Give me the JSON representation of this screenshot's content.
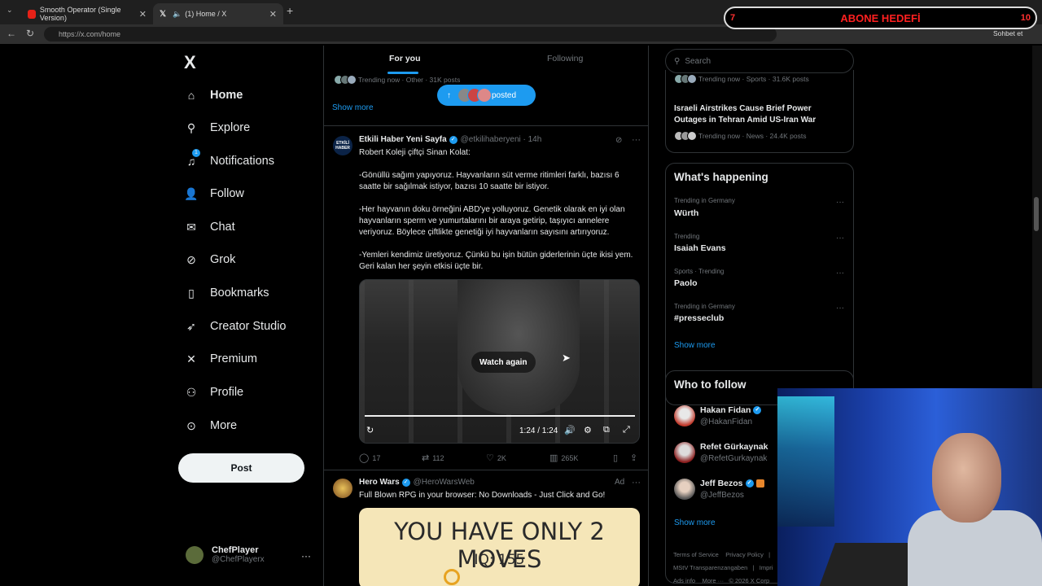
{
  "browser": {
    "tabs": [
      {
        "title": "Smooth Operator (Single Version)",
        "active": false
      },
      {
        "title": "(1) Home / X",
        "active": true
      }
    ],
    "url": "https://x.com/home",
    "chat_button": "Sohbet et"
  },
  "stream_overlay": {
    "banner": "ABONE HEDEFİ",
    "left_num": "7",
    "right_num": "10"
  },
  "sidebar": {
    "logo": "X",
    "items": [
      {
        "label": "Home",
        "icon": "home-icon"
      },
      {
        "label": "Explore",
        "icon": "search-icon"
      },
      {
        "label": "Notifications",
        "icon": "bell-icon",
        "badge": "1"
      },
      {
        "label": "Follow",
        "icon": "person-add-icon"
      },
      {
        "label": "Chat",
        "icon": "mail-icon"
      },
      {
        "label": "Grok",
        "icon": "grok-icon"
      },
      {
        "label": "Bookmarks",
        "icon": "bookmark-icon"
      },
      {
        "label": "Creator Studio",
        "icon": "rocket-icon"
      },
      {
        "label": "Premium",
        "icon": "x-icon"
      },
      {
        "label": "Profile",
        "icon": "person-icon"
      },
      {
        "label": "More",
        "icon": "more-circle-icon"
      }
    ],
    "post_button": "Post",
    "account": {
      "name": "ChefPlayer",
      "handle": "@ChefPlayerx"
    }
  },
  "feed": {
    "tabs": [
      "For you",
      "Following"
    ],
    "top_trend": "Trending now · Other · 31K posts",
    "show_more": "Show more",
    "posted_pill": "posted",
    "tweet1": {
      "name": "Etkili Haber Yeni Sayfa",
      "handle": "@etkilihaberyeni · 14h",
      "avatar_text": "ETKİLİ HABER",
      "body": "Robert Koleji çiftçi Sinan Kolat:\n\n-Gönüllü sağım yapıyoruz. Hayvanların süt verme ritimleri farklı, bazısı 6 saatte bir sağılmak istiyor, bazısı 10 saatte bir istiyor.\n\n-Her hayvanın doku örneğini ABD'ye yolluyoruz. Genetik olarak en iyi olan hayvanların sperm ve yumurtalarını bir araya getirip, taşıyıcı annelere veriyoruz. Böylece çiftlikte genetiği iyi hayvanların sayısını artırıyoruz.\n\n-Yemleri kendimiz üretiyoruz. Çünkü bu işin bütün giderlerinin üçte ikisi yem. Geri kalan her şeyin etkisi üçte bir.",
      "video": {
        "watch_again": "Watch again",
        "time": "1:24 / 1:24",
        "progress": 1.0
      },
      "stats": {
        "replies": "17",
        "reposts": "112",
        "likes": "2K",
        "views": "265K"
      }
    },
    "tweet2": {
      "name": "Hero Wars",
      "handle": "@HeroWarsWeb",
      "ad_label": "Ad",
      "body": "Full Blown RPG in your browser: No Downloads - Just Click and Go!",
      "image_text": "YOU HAVE ONLY 2 MOVES",
      "image_sub": "IQ: 155"
    }
  },
  "right": {
    "search_placeholder": "Search",
    "news_top": "Trending now · Sports · 31.6K posts",
    "news": {
      "headline": "Israeli Airstrikes Cause Brief Power Outages in Tehran Amid US-Iran War",
      "meta": "Trending now · News · 24.4K posts"
    },
    "whats_happening": {
      "title": "What's happening",
      "trends": [
        {
          "category": "Trending in Germany",
          "name": "Würth"
        },
        {
          "category": "Trending",
          "name": "Isaiah Evans"
        },
        {
          "category": "Sports · Trending",
          "name": "Paolo"
        },
        {
          "category": "Trending in Germany",
          "name": "#presseclub"
        }
      ],
      "show_more": "Show more"
    },
    "who_to_follow": {
      "title": "Who to follow",
      "users": [
        {
          "name": "Hakan Fidan",
          "handle": "@HakanFidan"
        },
        {
          "name": "Refet Gürkaynak",
          "handle": "@RefetGurkaynak"
        },
        {
          "name": "Jeff Bezos",
          "handle": "@JeffBezos"
        }
      ],
      "show_more": "Show more"
    },
    "footer": {
      "line1": [
        "Terms of Service",
        "Privacy Policy",
        "|"
      ],
      "line2": [
        "MStV Transparenzangaben",
        "|",
        "Impri"
      ],
      "line3": [
        "Ads info",
        "More ···",
        "© 2026 X Corp"
      ]
    }
  }
}
